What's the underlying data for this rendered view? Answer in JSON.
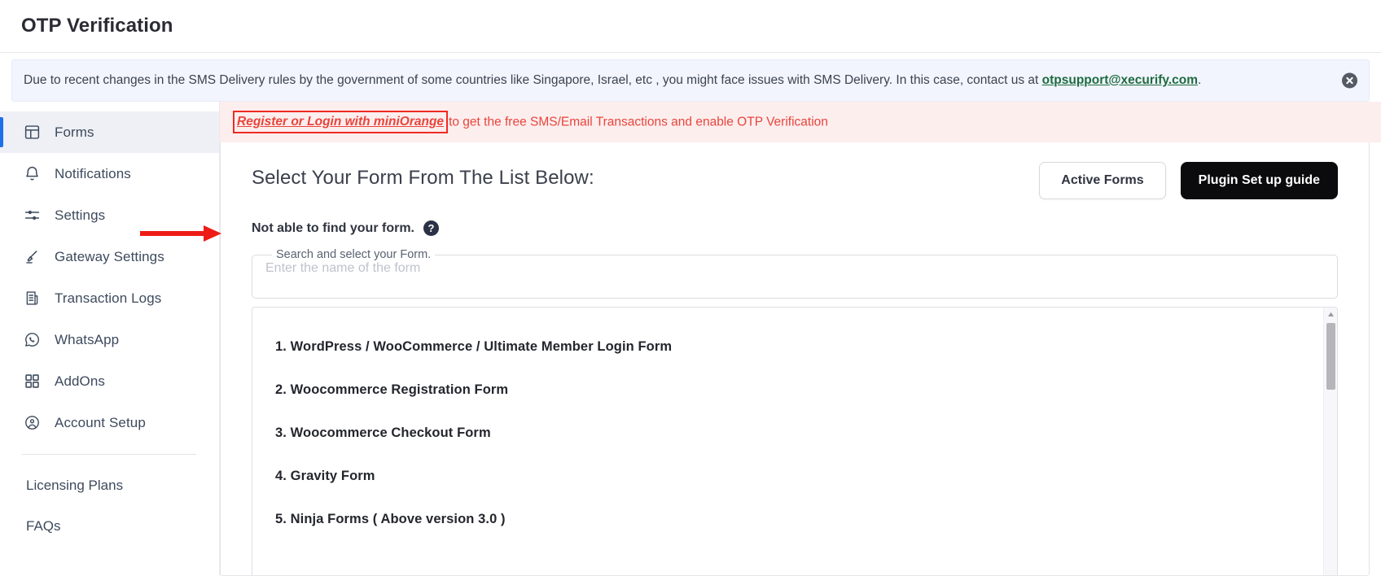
{
  "page": {
    "title": "OTP Verification"
  },
  "info_banner": {
    "text_before": "Due to recent changes in the SMS Delivery rules by the government of some countries like Singapore, Israel, etc , you might face issues with SMS Delivery. In this case, contact us at ",
    "email": "otpsupport@xecurify.com",
    "text_after": ".",
    "close_icon": "close-circle-icon",
    "bg_color": "#f2f5fd",
    "email_color": "#1d6b3f"
  },
  "alert": {
    "link_text": "Register or Login with miniOrange",
    "rest_text": "to get the free SMS/Email Transactions and enable OTP Verification",
    "color": "#e8453c",
    "bg_color": "#fdeeee",
    "highlight_border_color": "#ef2b23",
    "arrow_color": "#ee1c16"
  },
  "sidebar": {
    "items": [
      {
        "label": "Forms",
        "icon": "layout-forms-icon",
        "active": true
      },
      {
        "label": "Notifications",
        "icon": "bell-icon",
        "active": false
      },
      {
        "label": "Settings",
        "icon": "sliders-icon",
        "active": false
      },
      {
        "label": "Gateway Settings",
        "icon": "brush-icon",
        "active": false
      },
      {
        "label": "Transaction Logs",
        "icon": "receipt-list-icon",
        "active": false
      },
      {
        "label": "WhatsApp",
        "icon": "whatsapp-icon",
        "active": false
      },
      {
        "label": "AddOns",
        "icon": "grid-squares-icon",
        "active": false
      },
      {
        "label": "Account Setup",
        "icon": "user-circle-icon",
        "active": false
      }
    ],
    "plain_items": [
      {
        "label": "Licensing Plans"
      },
      {
        "label": "FAQs"
      }
    ],
    "active_indicator_color": "#1f6feb"
  },
  "main": {
    "heading": "Select Your Form From The List Below:",
    "buttons": {
      "active_forms": "Active Forms",
      "setup_guide": "Plugin Set up guide"
    },
    "not_found_label": "Not able to find your form.",
    "help_icon": "question-mark-circle-icon",
    "search": {
      "legend": "Search and select your Form.",
      "placeholder": "Enter the name of the form",
      "value": ""
    },
    "form_list": [
      "1. WordPress / WooCommerce / Ultimate Member Login Form",
      "2. Woocommerce Registration Form",
      "3. Woocommerce Checkout Form",
      "4. Gravity Form",
      "5. Ninja Forms ( Above version 3.0 )"
    ],
    "scrollbar": {
      "up_arrow_icon": "scroll-up-arrow-icon",
      "thumb_color": "#b6b6ba"
    }
  }
}
